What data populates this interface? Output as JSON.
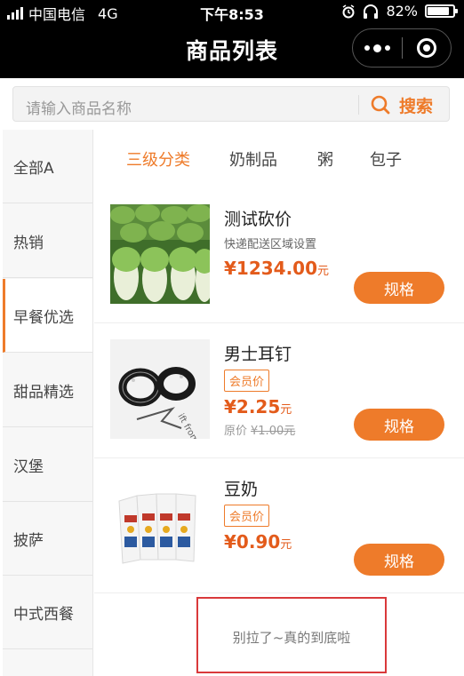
{
  "status": {
    "carrier": "中国电信",
    "network": "4G",
    "time": "下午8:53",
    "battery": "82%"
  },
  "nav": {
    "title": "商品列表"
  },
  "search": {
    "placeholder": "请输入商品名称",
    "button": "搜索"
  },
  "sidebar": {
    "items": [
      "全部A",
      "热销",
      "早餐优选",
      "甜品精选",
      "汉堡",
      "披萨",
      "中式西餐"
    ],
    "active_index": 2
  },
  "tabs": {
    "items": [
      "三级分类",
      "奶制品",
      "粥",
      "包子"
    ],
    "active_index": 0
  },
  "products": [
    {
      "name": "测试砍价",
      "subtitle": "快递配送区域设置",
      "price": "¥1234.00",
      "unit": "元",
      "button": "规格",
      "image": "cabbage"
    },
    {
      "name": "男士耳钉",
      "badge": "会员价",
      "price": "¥2.25",
      "unit": "元",
      "orig_label": "原价",
      "orig_price": "¥1.00元",
      "button": "规格",
      "image": "earrings"
    },
    {
      "name": "豆奶",
      "badge": "会员价",
      "price": "¥0.90",
      "unit": "元",
      "button": "规格",
      "image": "soymilk"
    }
  ],
  "end_note": "别拉了~真的到底啦",
  "colors": {
    "accent": "#ee7b2a",
    "price": "#e35b1b",
    "highlight_box": "#d9393b"
  }
}
